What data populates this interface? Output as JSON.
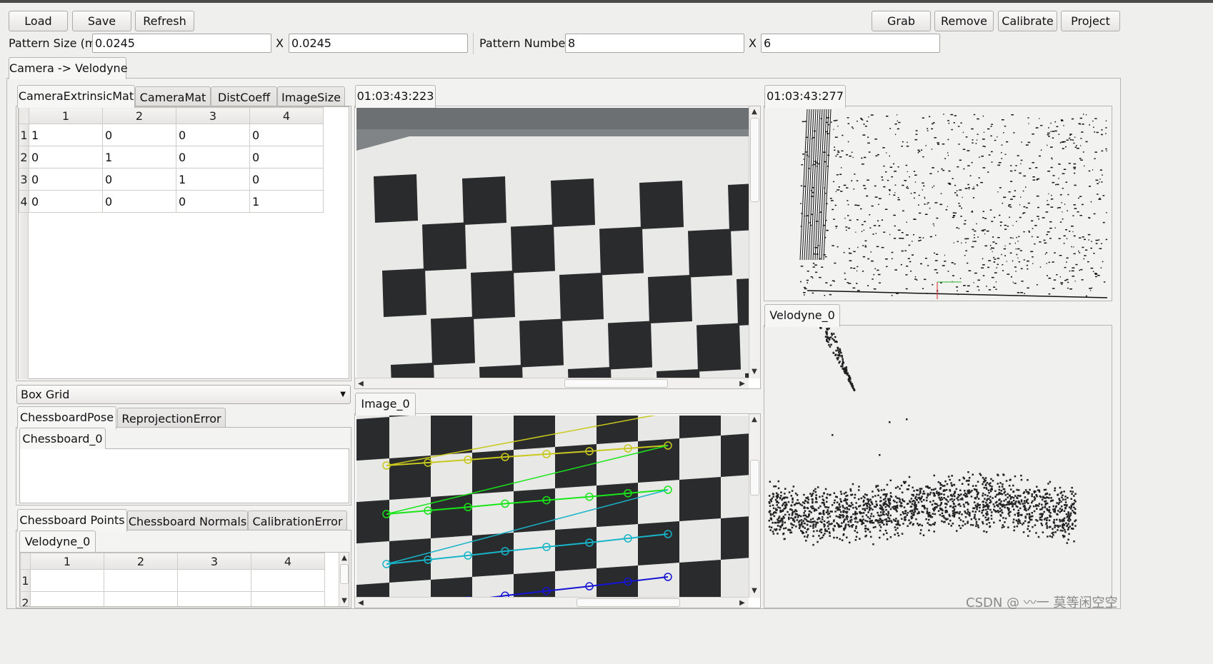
{
  "toolbar": {
    "load": "Load",
    "save": "Save",
    "refresh": "Refresh",
    "grab": "Grab",
    "remove": "Remove",
    "calibrate": "Calibrate",
    "project": "Project"
  },
  "pattern": {
    "size_label": "Pattern Size (m)",
    "size_x": "0.0245",
    "size_sep": "X",
    "size_y": "0.0245",
    "number_label": "Pattern Number",
    "number_x": "8",
    "number_sep": "X",
    "number_y": "6"
  },
  "main_tab": "Camera -> Velodyne",
  "matrix_tabs": [
    "CameraExtrinsicMat",
    "CameraMat",
    "DistCoeff",
    "ImageSize"
  ],
  "matrix": {
    "columns": [
      "1",
      "2",
      "3",
      "4"
    ],
    "rows": [
      {
        "h": "1",
        "cells": [
          "1",
          "0",
          "0",
          "0"
        ]
      },
      {
        "h": "2",
        "cells": [
          "0",
          "1",
          "0",
          "0"
        ]
      },
      {
        "h": "3",
        "cells": [
          "0",
          "0",
          "1",
          "0"
        ]
      },
      {
        "h": "4",
        "cells": [
          "0",
          "0",
          "0",
          "1"
        ]
      }
    ]
  },
  "combo": {
    "value": "Box Grid"
  },
  "pose_tabs": [
    "ChessboardPose",
    "ReprojectionError"
  ],
  "pose_subtab": "Chessboard_0",
  "points_tabs": [
    "Chessboard Points",
    "Chessboard Normals",
    "CalibrationError"
  ],
  "points_subtab": "Velodyne_0",
  "points_table": {
    "columns": [
      "1",
      "2",
      "3",
      "4"
    ],
    "rows": [
      "1",
      "2"
    ]
  },
  "camera_view": {
    "timestamp": "01:03:43:223"
  },
  "image_view": {
    "tab": "Image_0"
  },
  "lidar_view": {
    "timestamp": "01:03:43:277"
  },
  "velodyne_view": {
    "tab": "Velodyne_0"
  },
  "watermark": "CSDN @ 〰一 莫等闲空空",
  "colors": {
    "line_yellow": "#c8c81e",
    "line_green": "#19e619",
    "line_cyan": "#18b4c8",
    "line_blue": "#1414d2"
  }
}
